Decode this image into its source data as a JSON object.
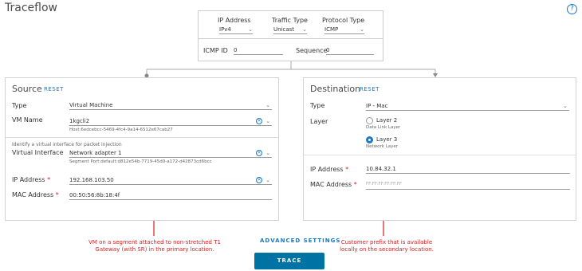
{
  "page": {
    "title": "Traceflow",
    "help_icon": "?"
  },
  "top": {
    "ip_address_label": "IP Address",
    "ip_address_value": "IPv4",
    "traffic_type_label": "Traffic Type",
    "traffic_type_value": "Unicast",
    "protocol_type_label": "Protocol Type",
    "protocol_type_value": "ICMP",
    "icmp_id_label": "ICMP ID",
    "icmp_id_value": "0",
    "sequence_label": "Sequence",
    "sequence_value": "0"
  },
  "source": {
    "title": "Source",
    "reset": "RESET",
    "type_label": "Type",
    "type_value": "Virtual Machine",
    "vm_name_label": "VM Name",
    "vm_name_value": "1kgcli2",
    "host_text": "Host:6edcebcc-5469-4fc4-9a14-6512e67cab27",
    "identify_text": "Identify a virtual interface for packet injection",
    "vif_label": "Virtual Interface",
    "vif_value": "Network adapter 1",
    "segment_port_text": "Segment Port:default:d812e54b-7719-45d0-a172-d42873cd6bcc",
    "ip_label": "IP Address",
    "ip_value": "192.168.103.50",
    "mac_label": "MAC Address",
    "mac_value": "00:50:56:8b:18:4f",
    "required_mark": "*"
  },
  "destination": {
    "title": "Destination",
    "reset": "RESET",
    "type_label": "Type",
    "type_value": "IP - Mac",
    "layer_label": "Layer",
    "layer2_label": "Layer 2",
    "layer2_sub": "Data Link Layer",
    "layer3_label": "Layer 3",
    "layer3_sub": "Network Layer",
    "ip_label": "IP Address",
    "ip_value": "10.84.32.1",
    "mac_label": "MAC Address",
    "mac_placeholder": "FF:FF:FF:FF:FF:FF",
    "required_mark": "*"
  },
  "actions": {
    "advanced_settings": "ADVANCED SETTINGS",
    "trace": "TRACE"
  },
  "annotations": {
    "left": "VM on a segment attached to non-stretched T1 Gateway (with SR) in the primary location.",
    "right": "Customer prefix that is available locally on the secondary location."
  },
  "colors": {
    "accent": "#1a79c8",
    "annotation": "#d81e1e",
    "button": "#0072a3"
  }
}
